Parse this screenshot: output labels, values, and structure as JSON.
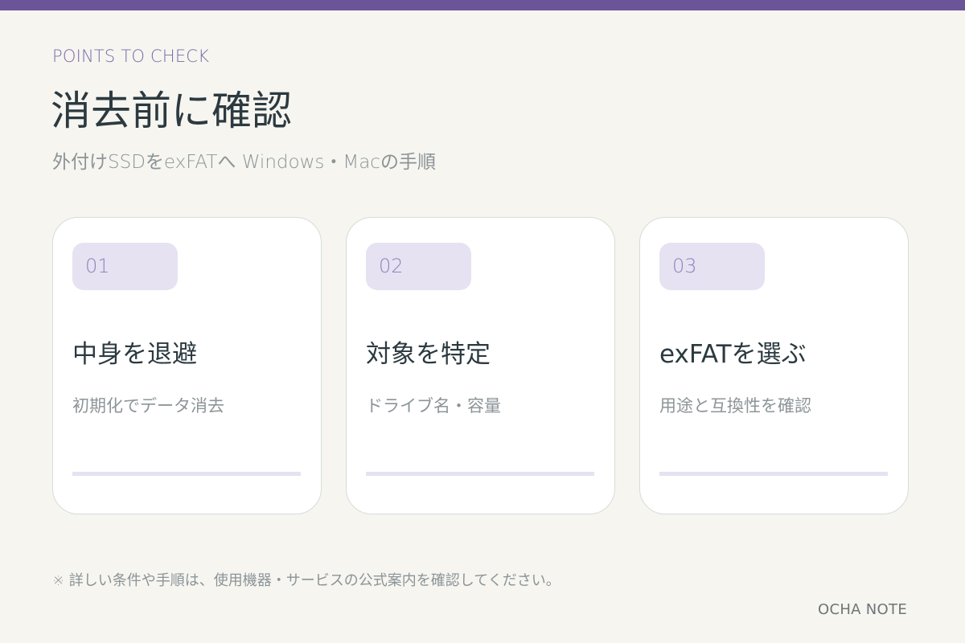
{
  "header": {
    "eyebrow": "POINTS TO CHECK",
    "title": "消去前に確認",
    "subtitle": "外付けSSDをexFATへ Windows・Macの手順"
  },
  "cards": [
    {
      "number": "01",
      "title": "中身を退避",
      "description": "初期化でデータ消去"
    },
    {
      "number": "02",
      "title": "対象を特定",
      "description": "ドライブ名・容量"
    },
    {
      "number": "03",
      "title": "exFATを選ぶ",
      "description": "用途と互換性を確認"
    }
  ],
  "footer": {
    "note": "※ 詳しい条件や手順は、使用機器・サービスの公式案内を確認してください。",
    "brand": "OCHA NOTE"
  },
  "colors": {
    "accent": "#6c5499",
    "background": "#f6f5f0",
    "badge": "#e6e2f2"
  }
}
